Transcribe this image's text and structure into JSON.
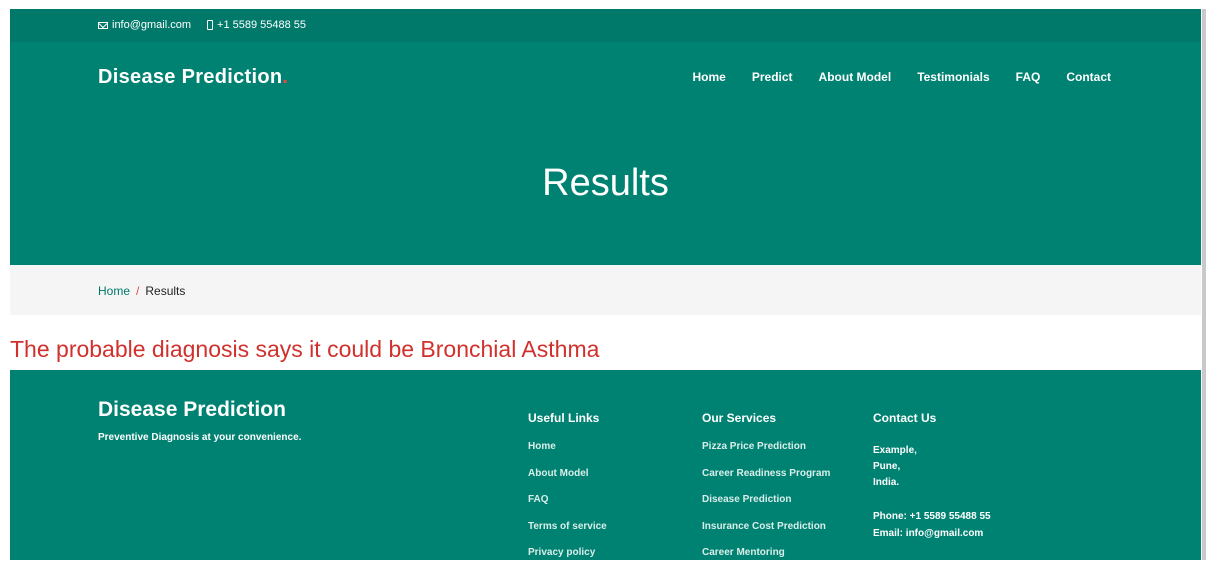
{
  "topbar": {
    "email": "info@gmail.com",
    "phone": "+1 5589 55488 55"
  },
  "header": {
    "logo_text": "Disease Prediction",
    "logo_dot": ".",
    "nav": [
      "Home",
      "Predict",
      "About Model",
      "Testimonials",
      "FAQ",
      "Contact"
    ]
  },
  "hero": {
    "title": "Results"
  },
  "breadcrumb": {
    "home": "Home",
    "separator": "/",
    "current": "Results"
  },
  "result": {
    "message": "The probable diagnosis says it could be Bronchial Asthma"
  },
  "footer": {
    "brand": "Disease Prediction",
    "tagline": "Preventive Diagnosis at your convenience.",
    "useful_links": {
      "title": "Useful Links",
      "items": [
        "Home",
        "About Model",
        "FAQ",
        "Terms of service",
        "Privacy policy"
      ]
    },
    "services": {
      "title": "Our Services",
      "items": [
        "Pizza Price Prediction",
        "Career Readiness Program",
        "Disease Prediction",
        "Insurance Cost Prediction",
        "Career Mentoring"
      ]
    },
    "contact": {
      "title": "Contact Us",
      "address": [
        "Example,",
        "Pune,",
        "India."
      ],
      "phone": "Phone: +1 5589 55488 55",
      "email": "Email: info@gmail.com"
    }
  },
  "colors": {
    "primary": "#008272",
    "topbar": "#00796b",
    "accent": "#e8493b",
    "result_text": "#d0312d"
  }
}
